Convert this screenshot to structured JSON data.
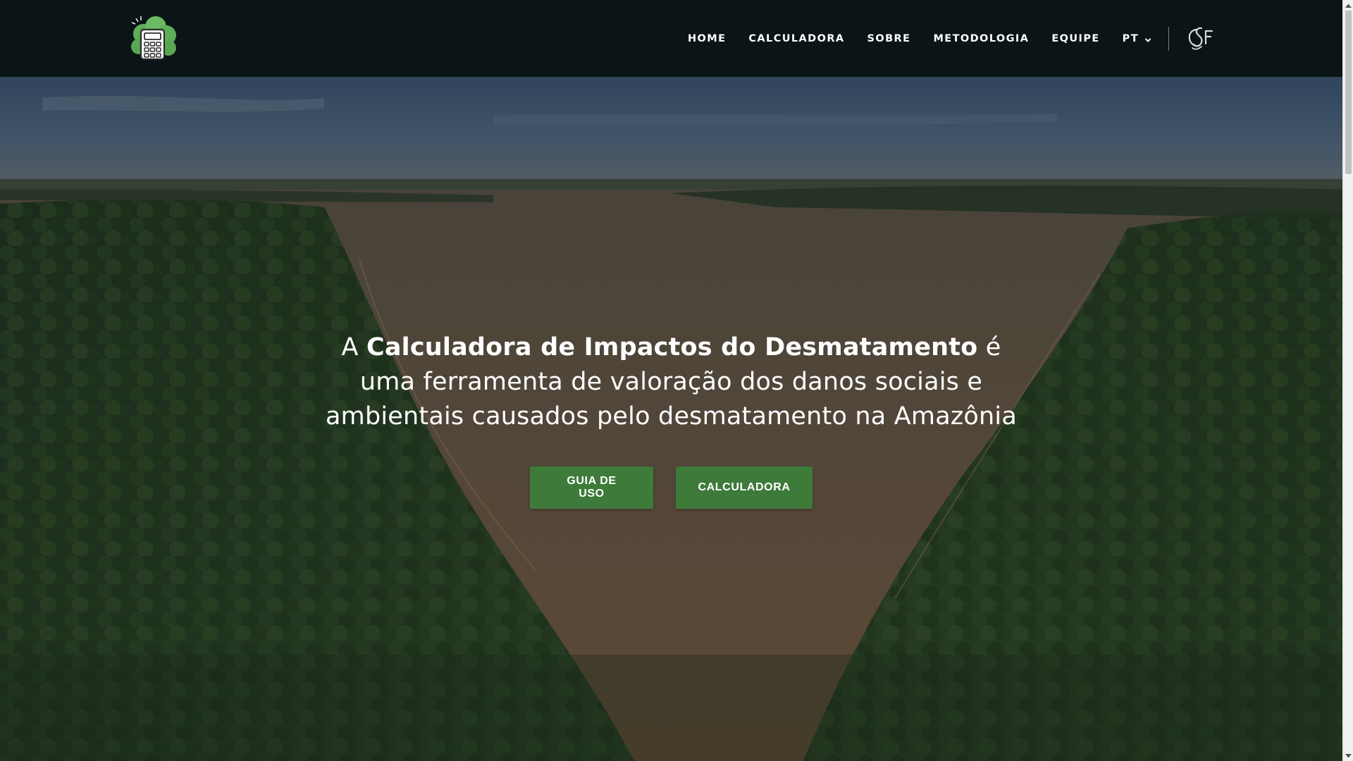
{
  "nav": {
    "items": [
      {
        "label": "HOME"
      },
      {
        "label": "CALCULADORA"
      },
      {
        "label": "SOBRE"
      },
      {
        "label": "METODOLOGIA"
      },
      {
        "label": "EQUIPE"
      }
    ],
    "language": {
      "label": "PT",
      "icon": "chevron-down-icon"
    },
    "logo_icon": "calculator-tree-icon",
    "partner_logo_icon": "csf-logo-icon"
  },
  "hero": {
    "intro": "A ",
    "title": "Calculadora de Impactos do Desmatamento",
    "after_title": " é",
    "line2": "uma ferramenta de valoração dos danos sociais e",
    "line3": "ambientais causados pelo desmatamento na Amazônia",
    "buttons": {
      "guide": "GUIA DE USO",
      "calculator": "CALCULADORA"
    }
  },
  "colors": {
    "navbar": "#0b1416",
    "button": "#3e7a3a",
    "text": "#ffffff"
  }
}
